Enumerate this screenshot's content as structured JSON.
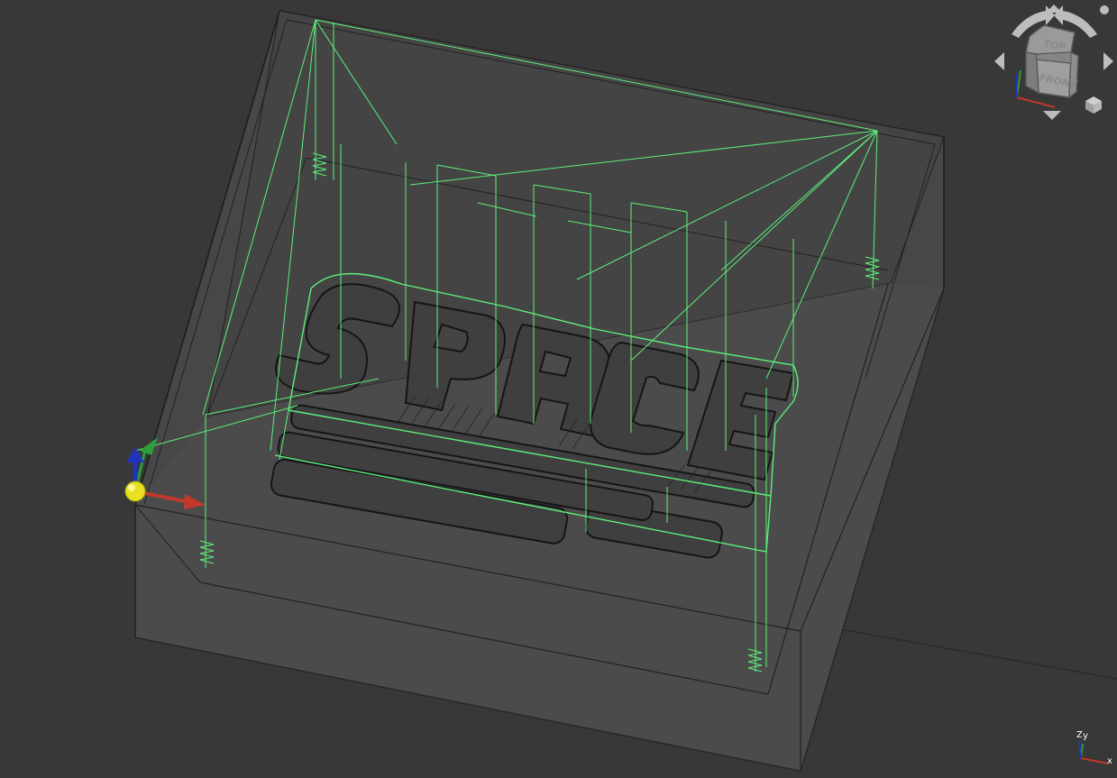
{
  "navigation_cube": {
    "face_top": "TOP",
    "face_front": "FRONT",
    "rotate_left_icon": "rotate-ccw-icon",
    "rotate_right_icon": "rotate-cw-icon",
    "arrow_up_icon": "arrow-up-icon",
    "arrow_down_icon": "arrow-down-icon",
    "arrow_left_icon": "arrow-left-icon",
    "arrow_right_icon": "arrow-right-icon",
    "menu_icon": "menu-dot-icon",
    "view_icon": "cube-view-icon"
  },
  "axis_indicator": {
    "label_z": "Z",
    "label_y": "y",
    "label_x": "x"
  },
  "colors": {
    "background": "#383838",
    "toolpath": "#5cf07a",
    "stock_fill": "#4d4d4d",
    "axis_x": "#c0392b",
    "axis_y": "#2e9e3a",
    "axis_z": "#2233bb",
    "origin_sphere": "#e8e020"
  }
}
